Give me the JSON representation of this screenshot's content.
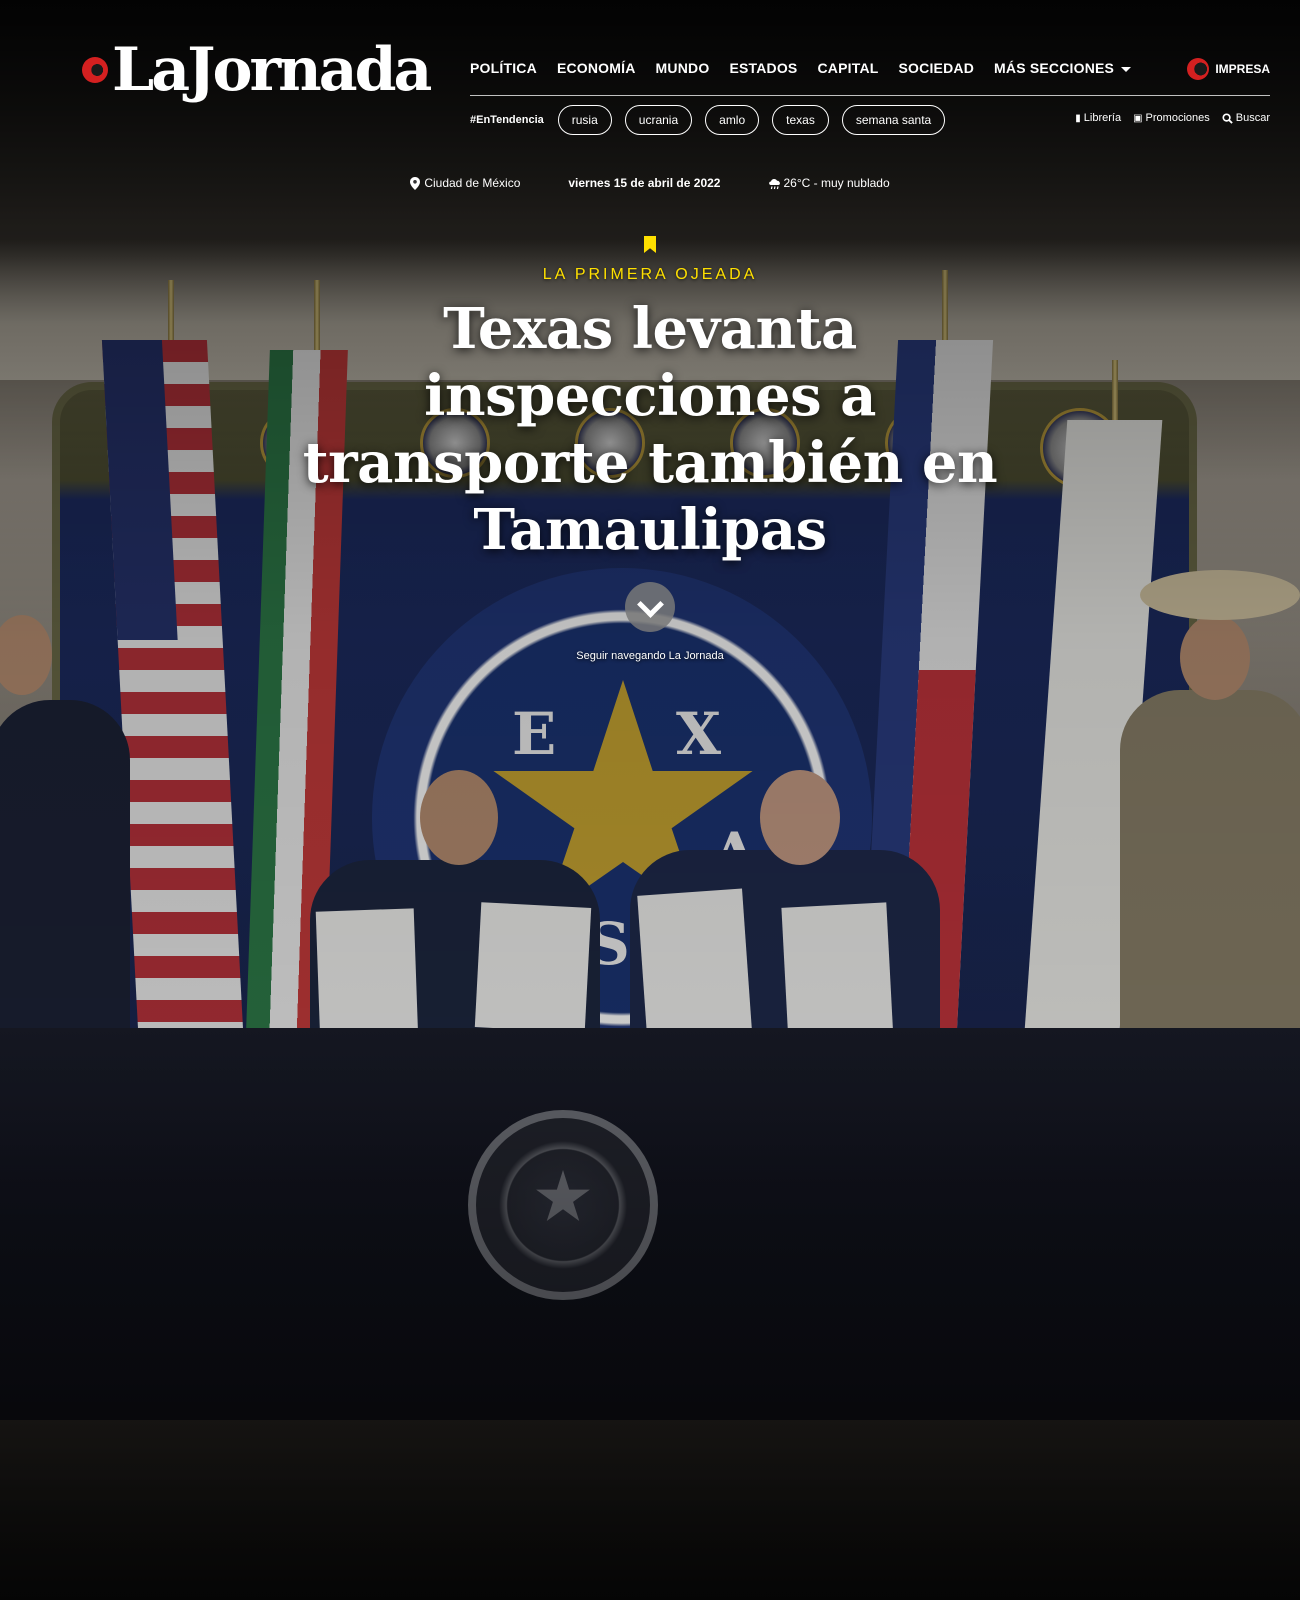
{
  "header": {
    "logo_text": "LaJornada",
    "nav": [
      {
        "label": "POLÍTICA"
      },
      {
        "label": "ECONOMÍA"
      },
      {
        "label": "MUNDO"
      },
      {
        "label": "ESTADOS"
      },
      {
        "label": "CAPITAL"
      },
      {
        "label": "SOCIEDAD"
      },
      {
        "label": "MÁS SECCIONES"
      }
    ],
    "impresa_label": "IMPRESA",
    "trending_label": "#EnTendencia",
    "trending_tags": [
      "rusia",
      "ucrania",
      "amlo",
      "texas",
      "semana santa"
    ],
    "utility_links": [
      {
        "label": "Librería",
        "icon": "book-icon"
      },
      {
        "label": "Promociones",
        "icon": "gift-icon"
      },
      {
        "label": "Buscar",
        "icon": "search-icon"
      }
    ]
  },
  "info_bar": {
    "location": "Ciudad de México",
    "date": "viernes 15 de abril de 2022",
    "weather": "26°C - muy nublado"
  },
  "hero": {
    "kicker": "LA PRIMERA OJEADA",
    "headline": "Texas levanta inspecciones a transporte también en Tamaulipas",
    "scroll_label": "Seguir navegando La Jornada"
  },
  "colors": {
    "accent_yellow": "#ffe000",
    "brand_red": "#d42020"
  }
}
